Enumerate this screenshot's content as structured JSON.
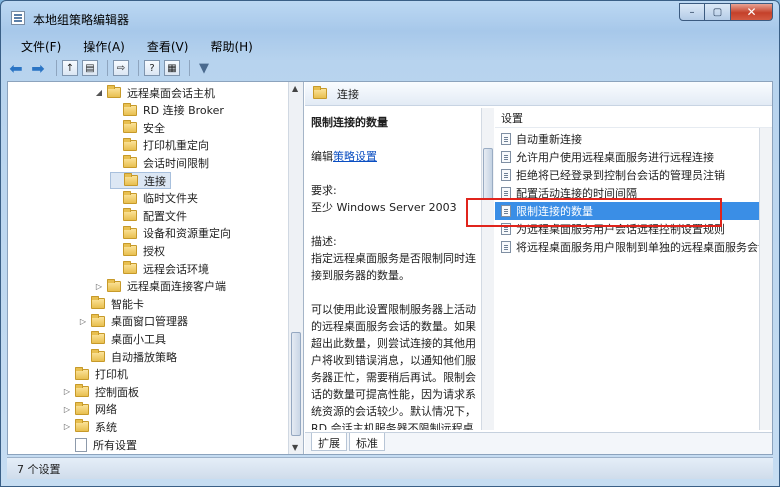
{
  "window": {
    "title": "本地组策略编辑器",
    "controls": {
      "minimize": "–",
      "maximize": "▢",
      "close": "✕"
    }
  },
  "menu": [
    "文件(F)",
    "操作(A)",
    "查看(V)",
    "帮助(H)"
  ],
  "tree": [
    {
      "label": "远程桌面会话主机",
      "expander": "◢",
      "icon": "folder"
    },
    {
      "label": "RD 连接 Broker",
      "expander": "",
      "icon": "folder"
    },
    {
      "label": "安全",
      "expander": "",
      "icon": "folder"
    },
    {
      "label": "打印机重定向",
      "expander": "",
      "icon": "folder"
    },
    {
      "label": "会话时间限制",
      "expander": "",
      "icon": "folder"
    },
    {
      "label": "连接",
      "expander": "",
      "icon": "folder",
      "selected": true
    },
    {
      "label": "临时文件夹",
      "expander": "",
      "icon": "folder"
    },
    {
      "label": "配置文件",
      "expander": "",
      "icon": "folder"
    },
    {
      "label": "设备和资源重定向",
      "expander": "",
      "icon": "folder"
    },
    {
      "label": "授权",
      "expander": "",
      "icon": "folder"
    },
    {
      "label": "远程会话环境",
      "expander": "",
      "icon": "folder"
    },
    {
      "label": "远程桌面连接客户端",
      "expander": "▷",
      "icon": "folder"
    },
    {
      "label": "智能卡",
      "expander": "",
      "icon": "folder"
    },
    {
      "label": "桌面窗口管理器",
      "expander": "▷",
      "icon": "folder"
    },
    {
      "label": "桌面小工具",
      "expander": "",
      "icon": "folder"
    },
    {
      "label": "自动播放策略",
      "expander": "",
      "icon": "folder"
    },
    {
      "label": "打印机",
      "expander": "",
      "icon": "folder"
    },
    {
      "label": "控制面板",
      "expander": "▷",
      "icon": "folder"
    },
    {
      "label": "网络",
      "expander": "▷",
      "icon": "folder"
    },
    {
      "label": "系统",
      "expander": "▷",
      "icon": "folder"
    },
    {
      "label": "所有设置",
      "expander": "",
      "icon": "doc"
    }
  ],
  "right": {
    "header": "连接",
    "desc": {
      "title": "限制连接的数量",
      "edit_prefix": "编辑",
      "edit_link": "策略设置",
      "req_label": "要求:",
      "req_value": "至少 Windows Server 2003",
      "desc_label": "描述:",
      "desc_text": "指定远程桌面服务是否限制同时连接到服务器的数量。",
      "desc_more": "可以使用此设置限制服务器上活动的远程桌面服务会话的数量。如果超出此数量，则尝试连接的其他用户将收到错误消息，以通知他们服务器正忙，需要稍后再试。限制会话的数量可提高性能，因为请求系统资源的会话较少。默认情况下，RD 会话主机服务器不限制远程桌面服务会话的数量，并且管理远程桌面允许两个远程桌面服务会话。"
    },
    "settings_header": "设置",
    "settings": [
      "自动重新连接",
      "允许用户使用远程桌面服务进行远程连接",
      "拒绝将已经登录到控制台会话的管理员注销",
      "配置活动连接的时间间隔",
      "限制连接的数量",
      "为远程桌面服务用户会话远程控制设置规则",
      "将远程桌面服务用户限制到单独的远程桌面服务会话"
    ],
    "selected_setting": "限制连接的数量",
    "tabs": [
      "扩展",
      "标准"
    ]
  },
  "status": "7 个设置"
}
